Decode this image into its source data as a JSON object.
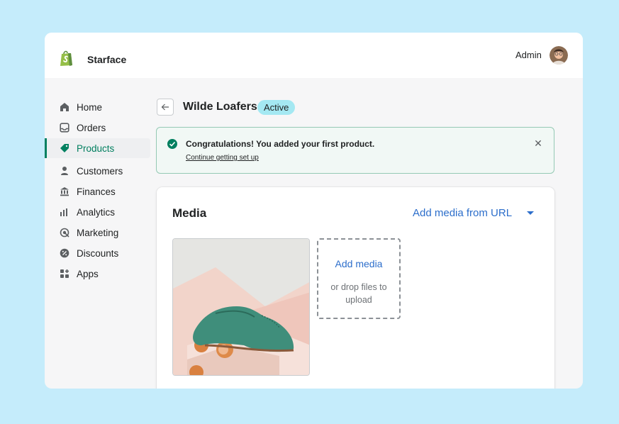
{
  "header": {
    "store_name": "Starface",
    "admin_label": "Admin",
    "logo_icon": "shopify-bag-icon"
  },
  "sidebar": {
    "items": [
      {
        "label": "Home",
        "icon": "home-icon",
        "active": false
      },
      {
        "label": "Orders",
        "icon": "orders-icon",
        "active": false
      },
      {
        "label": "Products",
        "icon": "tag-icon",
        "active": true
      },
      {
        "label": "Customers",
        "icon": "person-icon",
        "active": false
      },
      {
        "label": "Finances",
        "icon": "bank-icon",
        "active": false
      },
      {
        "label": "Analytics",
        "icon": "bar-chart-icon",
        "active": false
      },
      {
        "label": "Marketing",
        "icon": "target-icon",
        "active": false
      },
      {
        "label": "Discounts",
        "icon": "discount-icon",
        "active": false
      },
      {
        "label": "Apps",
        "icon": "apps-icon",
        "active": false
      }
    ]
  },
  "page": {
    "title": "Wilde Loafers",
    "status": "Active"
  },
  "banner": {
    "title": "Congratulations! You added your first product.",
    "link": "Continue getting set up"
  },
  "media": {
    "title": "Media",
    "add_from_url": "Add media from URL",
    "dropzone_title": "Add media",
    "dropzone_hint": "or drop files to upload"
  },
  "colors": {
    "accent_green": "#008060",
    "link_blue": "#2c6ecb",
    "badge_bg": "#a4e8f2",
    "page_bg": "#c5ecfb"
  }
}
